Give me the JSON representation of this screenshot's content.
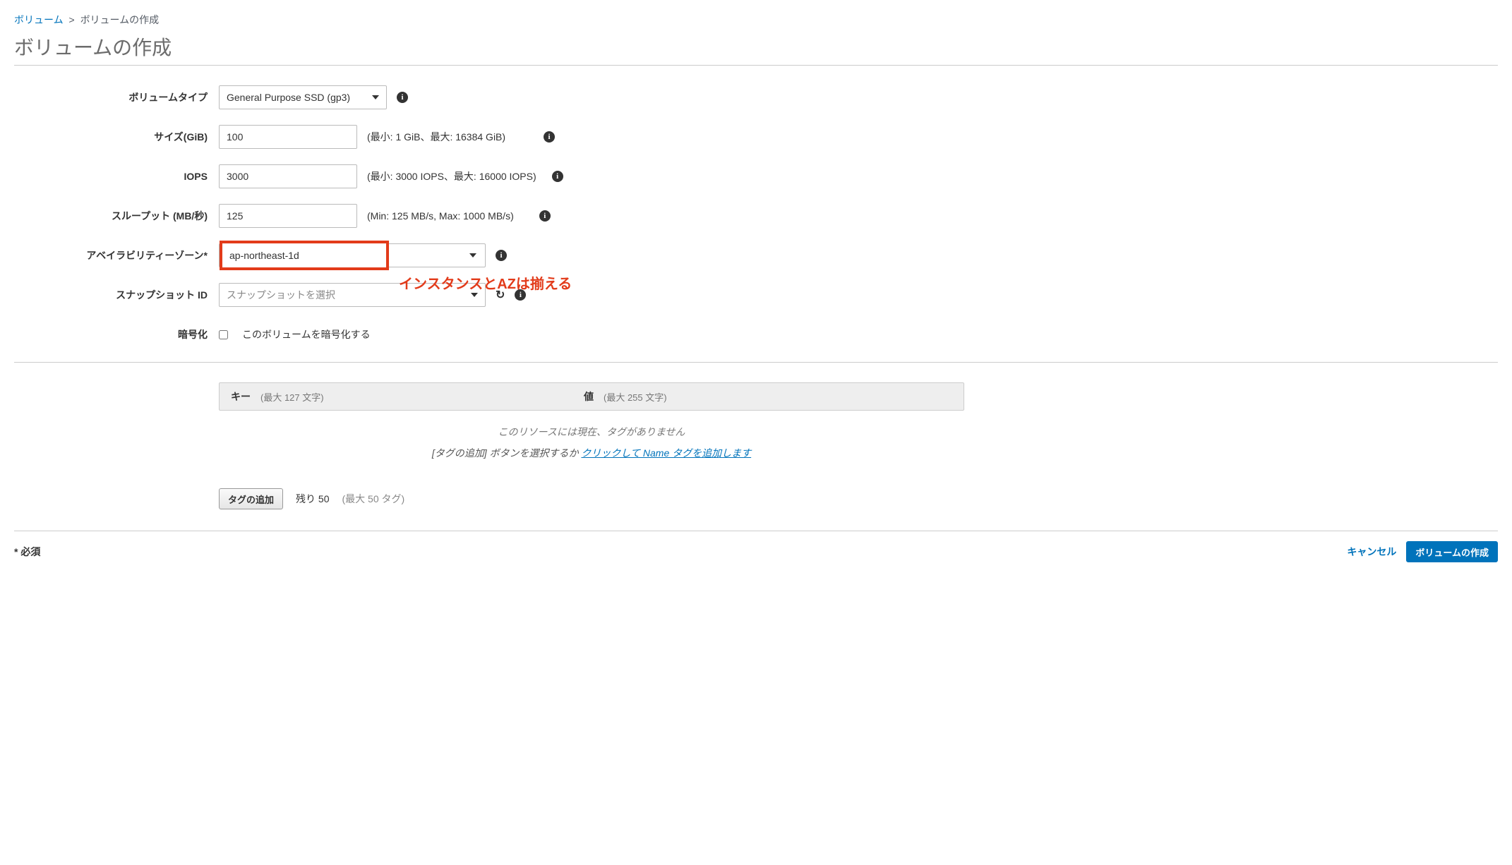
{
  "breadcrumb": {
    "root": "ボリューム",
    "current": "ボリュームの作成"
  },
  "page_title": "ボリュームの作成",
  "labels": {
    "volume_type": "ボリュームタイプ",
    "size": "サイズ(GiB)",
    "iops": "IOPS",
    "throughput": "スループット (MB/秒)",
    "az": "アベイラビリティーゾーン*",
    "snapshot": "スナップショット ID",
    "encrypt": "暗号化"
  },
  "values": {
    "volume_type": "General Purpose SSD (gp3)",
    "size": "100",
    "iops": "3000",
    "throughput": "125",
    "az": "ap-northeast-1d",
    "snapshot_placeholder": "スナップショットを選択",
    "encrypt_label": "このボリュームを暗号化する"
  },
  "hints": {
    "size": "(最小: 1 GiB、最大: 16384 GiB)",
    "iops": "(最小: 3000 IOPS、最大: 16000 IOPS)",
    "throughput": "(Min: 125 MB/s, Max: 1000 MB/s)"
  },
  "annotation": "インスタンスとAZは揃える",
  "tags": {
    "header_key": "キー",
    "header_key_hint": "(最大 127 文字)",
    "header_value": "値",
    "header_value_hint": "(最大 255 文字)",
    "empty": "このリソースには現在、タグがありません",
    "add_hint_pre": "[タグの追加] ボタンを選択するか",
    "add_hint_link": "クリックして Name タグを追加します",
    "add_button": "タグの追加",
    "remaining": "残り 50",
    "remaining_hint": "(最大 50 タグ)"
  },
  "footer": {
    "required": "* 必須",
    "cancel": "キャンセル",
    "submit": "ボリュームの作成"
  }
}
